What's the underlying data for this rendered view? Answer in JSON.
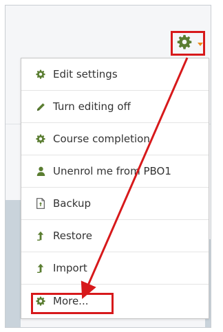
{
  "menu": {
    "items": [
      {
        "label": "Edit settings",
        "icon": "gear-icon"
      },
      {
        "label": "Turn editing off",
        "icon": "pencil-icon"
      },
      {
        "label": "Course completion",
        "icon": "gear-icon"
      },
      {
        "label": "Unenrol me from PBO1",
        "icon": "user-icon"
      },
      {
        "label": "Backup",
        "icon": "file-icon"
      },
      {
        "label": "Restore",
        "icon": "upload-arrow-icon"
      },
      {
        "label": "Import",
        "icon": "upload-arrow-icon"
      },
      {
        "label": "More...",
        "icon": "gear-icon"
      }
    ]
  },
  "colors": {
    "icon_green": "#5a7d31",
    "highlight_red": "#d7191b",
    "caret_orange": "#ef8a1a"
  }
}
